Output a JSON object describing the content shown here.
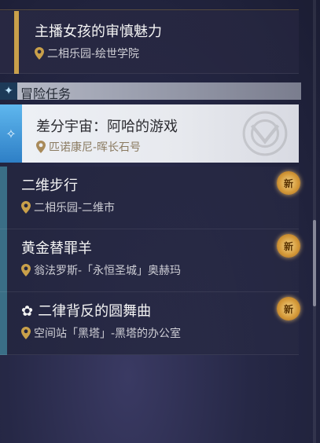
{
  "missions_top": [
    {
      "title": "主播女孩的审慎魅力",
      "location": "二相乐园-绘世学院"
    }
  ],
  "section": {
    "title": "冒险任务"
  },
  "selected": {
    "title": "差分宇宙：阿哈的游戏",
    "location": "匹诺康尼-晖长石号"
  },
  "missions": [
    {
      "title": "二维步行",
      "location": "二相乐园-二维市",
      "badge": "新"
    },
    {
      "title": "黄金替罪羊",
      "location": "翁法罗斯-「永恒圣城」奥赫玛",
      "badge": "新"
    },
    {
      "title": "二律背反的圆舞曲",
      "location": "空间站「黑塔」-黑塔的办公室",
      "badge": "新"
    }
  ],
  "colors": {
    "accent_gold": "#c9a04a",
    "accent_blue": "#3a6e86",
    "selected_bg": "#eef1f6"
  }
}
